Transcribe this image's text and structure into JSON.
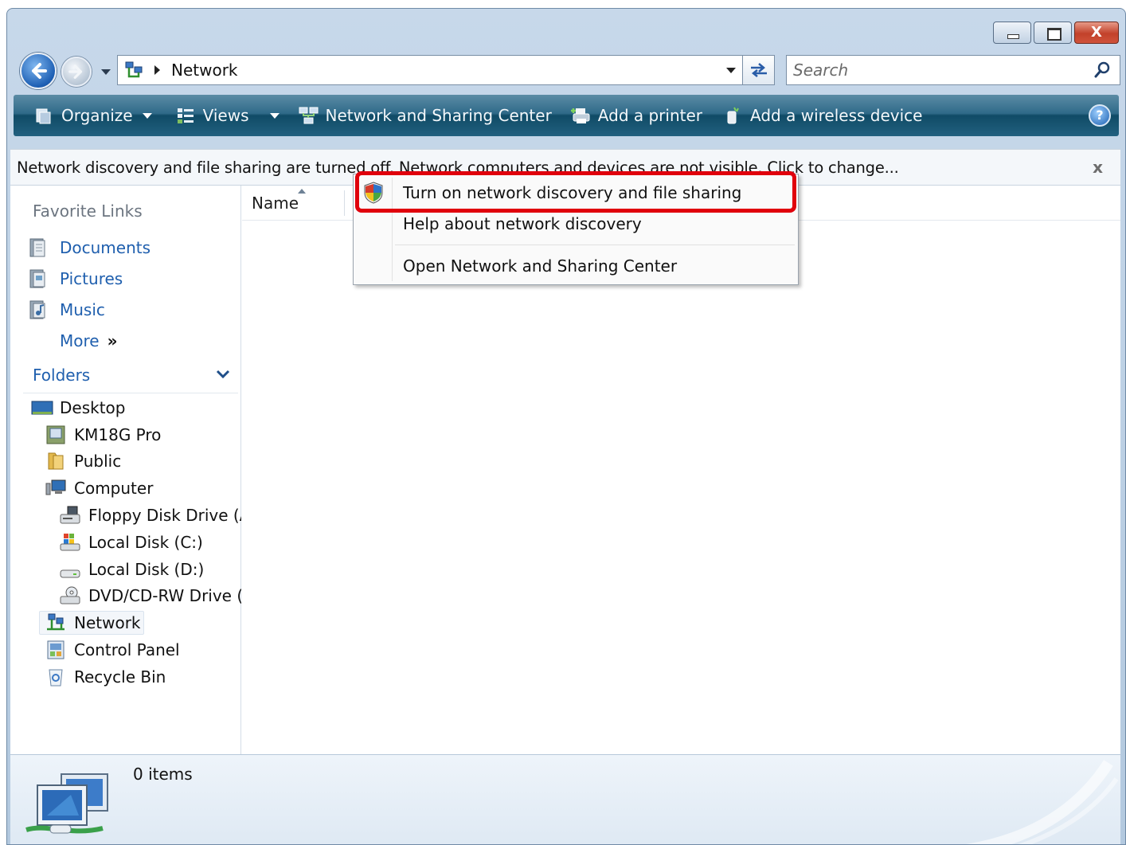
{
  "window": {
    "caption_buttons": [
      "minimize",
      "maximize",
      "close"
    ],
    "close_glyph": "X"
  },
  "address_bar": {
    "location": "Network",
    "icon": "network-icon"
  },
  "search": {
    "placeholder": "Search"
  },
  "toolbar": {
    "items": [
      {
        "label": "Organize",
        "icon": "organize-icon",
        "has_dropdown": true
      },
      {
        "label": "Views",
        "icon": "views-icon",
        "has_dropdown": true
      },
      {
        "label": "Network and Sharing Center",
        "icon": "network-sharing-icon",
        "has_dropdown": false
      },
      {
        "label": "Add a printer",
        "icon": "printer-icon",
        "has_dropdown": false
      },
      {
        "label": "Add a wireless device",
        "icon": "wireless-device-icon",
        "has_dropdown": false
      }
    ],
    "help_glyph": "?"
  },
  "infobar": {
    "message": "Network discovery and file sharing are turned off. Network computers and devices are not visible. Click to change...",
    "close_glyph": "x"
  },
  "favorite_links": {
    "heading": "Favorite Links",
    "items": [
      {
        "label": "Documents",
        "icon": "documents-icon"
      },
      {
        "label": "Pictures",
        "icon": "pictures-icon"
      },
      {
        "label": "Music",
        "icon": "music-icon"
      }
    ],
    "more_label": "More",
    "more_glyph": "»"
  },
  "folders": {
    "heading": "Folders",
    "tree": [
      {
        "label": "Desktop",
        "icon": "desktop-icon",
        "level": 0
      },
      {
        "label": "KM18G Pro",
        "icon": "user-folder-icon",
        "level": 1
      },
      {
        "label": "Public",
        "icon": "folder-icon",
        "level": 1
      },
      {
        "label": "Computer",
        "icon": "computer-icon",
        "level": 1
      },
      {
        "label": "Floppy Disk Drive (A",
        "icon": "floppy-drive-icon",
        "level": 2
      },
      {
        "label": "Local Disk (C:)",
        "icon": "system-disk-icon",
        "level": 2
      },
      {
        "label": "Local Disk (D:)",
        "icon": "disk-icon",
        "level": 2
      },
      {
        "label": "DVD/CD-RW Drive (",
        "icon": "dvd-drive-icon",
        "level": 2
      },
      {
        "label": "Network",
        "icon": "network-icon",
        "level": 1,
        "selected": true
      },
      {
        "label": "Control Panel",
        "icon": "control-panel-icon",
        "level": 1
      },
      {
        "label": "Recycle Bin",
        "icon": "recycle-bin-icon",
        "level": 1
      }
    ]
  },
  "file_list": {
    "columns": [
      "Name"
    ]
  },
  "context_menu": {
    "items": [
      {
        "label": "Turn on network discovery and file sharing",
        "icon": "uac-shield-icon",
        "highlighted": true
      },
      {
        "label": "Help about network discovery"
      },
      {
        "label": "Open Network and Sharing Center"
      }
    ],
    "highlight_color": "#e0000c"
  },
  "details_pane": {
    "item_count": "0 items",
    "icon": "network-computers-icon"
  },
  "colors": {
    "toolbar": "#2f6a89",
    "link": "#1f5fae",
    "highlight": "#e0000c"
  }
}
